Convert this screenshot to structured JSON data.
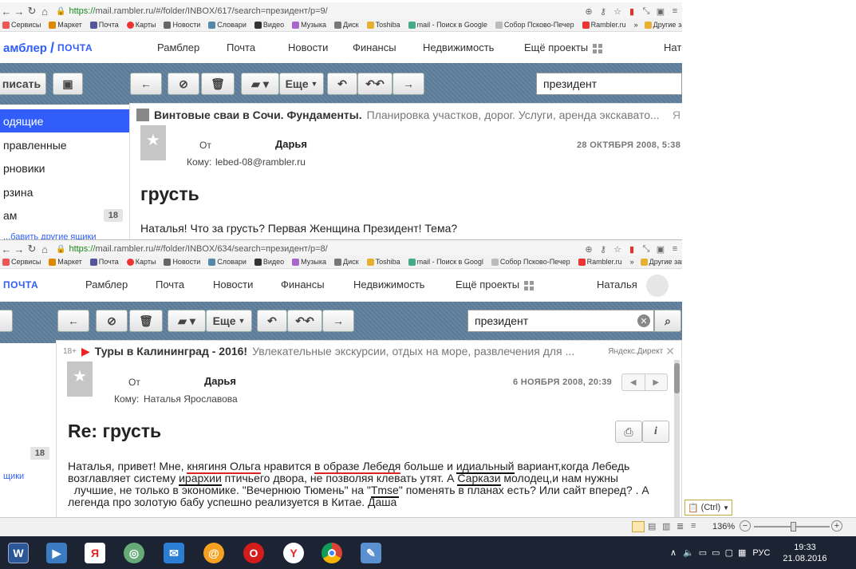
{
  "browser1": {
    "url_https": "https://",
    "url_rest": "mail.rambler.ru/#/folder/INBOX/617/search=президент/p=9/"
  },
  "browser2": {
    "url_https": "https://",
    "url_rest": "mail.rambler.ru/#/folder/INBOX/634/search=президент/p=8/"
  },
  "bookmarks1": [
    "Сервисы",
    "Маркет",
    "Почта",
    "Карты",
    "Новости",
    "Словари",
    "Видео",
    "Музыка",
    "Диск",
    "Toshiba",
    "mail - Поиск в Google",
    "Собор Псково-Печер",
    "Rambler.ru"
  ],
  "bookmarks2": [
    "Сервисы",
    "Маркет",
    "Почта",
    "Карты",
    "Новости",
    "Словари",
    "Видео",
    "Музыка",
    "Диск",
    "Toshiba",
    "mail - Поиск в Googl",
    "Собор Псково-Печер",
    "Rambler.ru"
  ],
  "other_bookmarks1": "Другие закладки",
  "other_bookmarks2": "Другие закладки",
  "nav1": {
    "logo": "амблер",
    "slash": "/",
    "pochta": "ПОЧТА",
    "items": [
      "Рамблер",
      "Почта",
      "Новости",
      "Финансы",
      "Недвижимость",
      "Ещё проекты",
      "Нат"
    ]
  },
  "nav2": {
    "pochta": "ПОЧТА",
    "items": [
      "Рамблер",
      "Почта",
      "Новости",
      "Финансы",
      "Недвижимость",
      "Ещё проекты"
    ],
    "user": "Наталья"
  },
  "toolbar1": {
    "write": "писать",
    "more": "Еще",
    "search": "президент"
  },
  "toolbar2": {
    "more": "Еще",
    "search": "президент"
  },
  "sidebar1": {
    "items": [
      "одящие",
      "правленные",
      "рновики",
      "рзина",
      "ам"
    ],
    "spam_count": "18",
    "setup_link": "...бавить другие ящики"
  },
  "sidebar2": {
    "spam_count": "18",
    "link": "щики"
  },
  "mail1": {
    "ad_title": "Винтовые сваи в Сочи. Фундаменты.",
    "ad_desc": "Планировка участков, дорог. Услуги, аренда экскавато...",
    "ad_mark": "Я",
    "from_label": "От",
    "sender": "Дарья",
    "to_label": "Кому:",
    "to": "lebed-08@rambler.ru",
    "date": "28 ОКТЯБРЯ 2008, 5:38",
    "subject": "грусть",
    "body": "Наталья! Что за грусть? Первая Женщина Президент! Тема?"
  },
  "mail2": {
    "age": "18+",
    "ad_title": "Туры в Калининград - 2016!",
    "ad_desc": "Увлекательные экскурсии, отдых на море, развлечения для ...",
    "ad_source": "Яндекс.Директ",
    "from_label": "От",
    "sender": "Дарья",
    "to_label": "Кому:",
    "to": "Наталья Ярославова",
    "date": "6 НОЯБРЯ 2008, 20:39",
    "subject": "Re: грусть",
    "body": {
      "l1a": "Наталья, привет! Мне, ",
      "l1b": "княгиня Ольга",
      "l1c": " нравится ",
      "l1d": "в образе Лебедя",
      "l1e": " больше и ",
      "l1f": "идиальный",
      "l1g": " вариант,когда Лебедь",
      "l2a": "возглавляет систему ",
      "l2b": "ирархии",
      "l2c": " птичьего двора, не позволяя клевать утят. А ",
      "l2d": "Саркази",
      "l2e": " молодец,и нам нужны",
      "l3a": "  лучшие, не только в экономике. \"Вечернюю Тюмень\" на \"",
      "l3b": "Tmse",
      "l3c": "\" поменять в планах есть? Или сайт вперед? . А",
      "l4": "легенда про золотую бабу успешно реализуется в Китае. Даша"
    }
  },
  "paste_hint": "(Ctrl)",
  "zoom": "136%",
  "tray": {
    "lang": "РУС",
    "time": "19:33",
    "date": "21.08.2016"
  },
  "colors": {
    "rambler_blue": "#315efb",
    "denim": "#5f7f9c",
    "taskbar": "#1c2433"
  }
}
